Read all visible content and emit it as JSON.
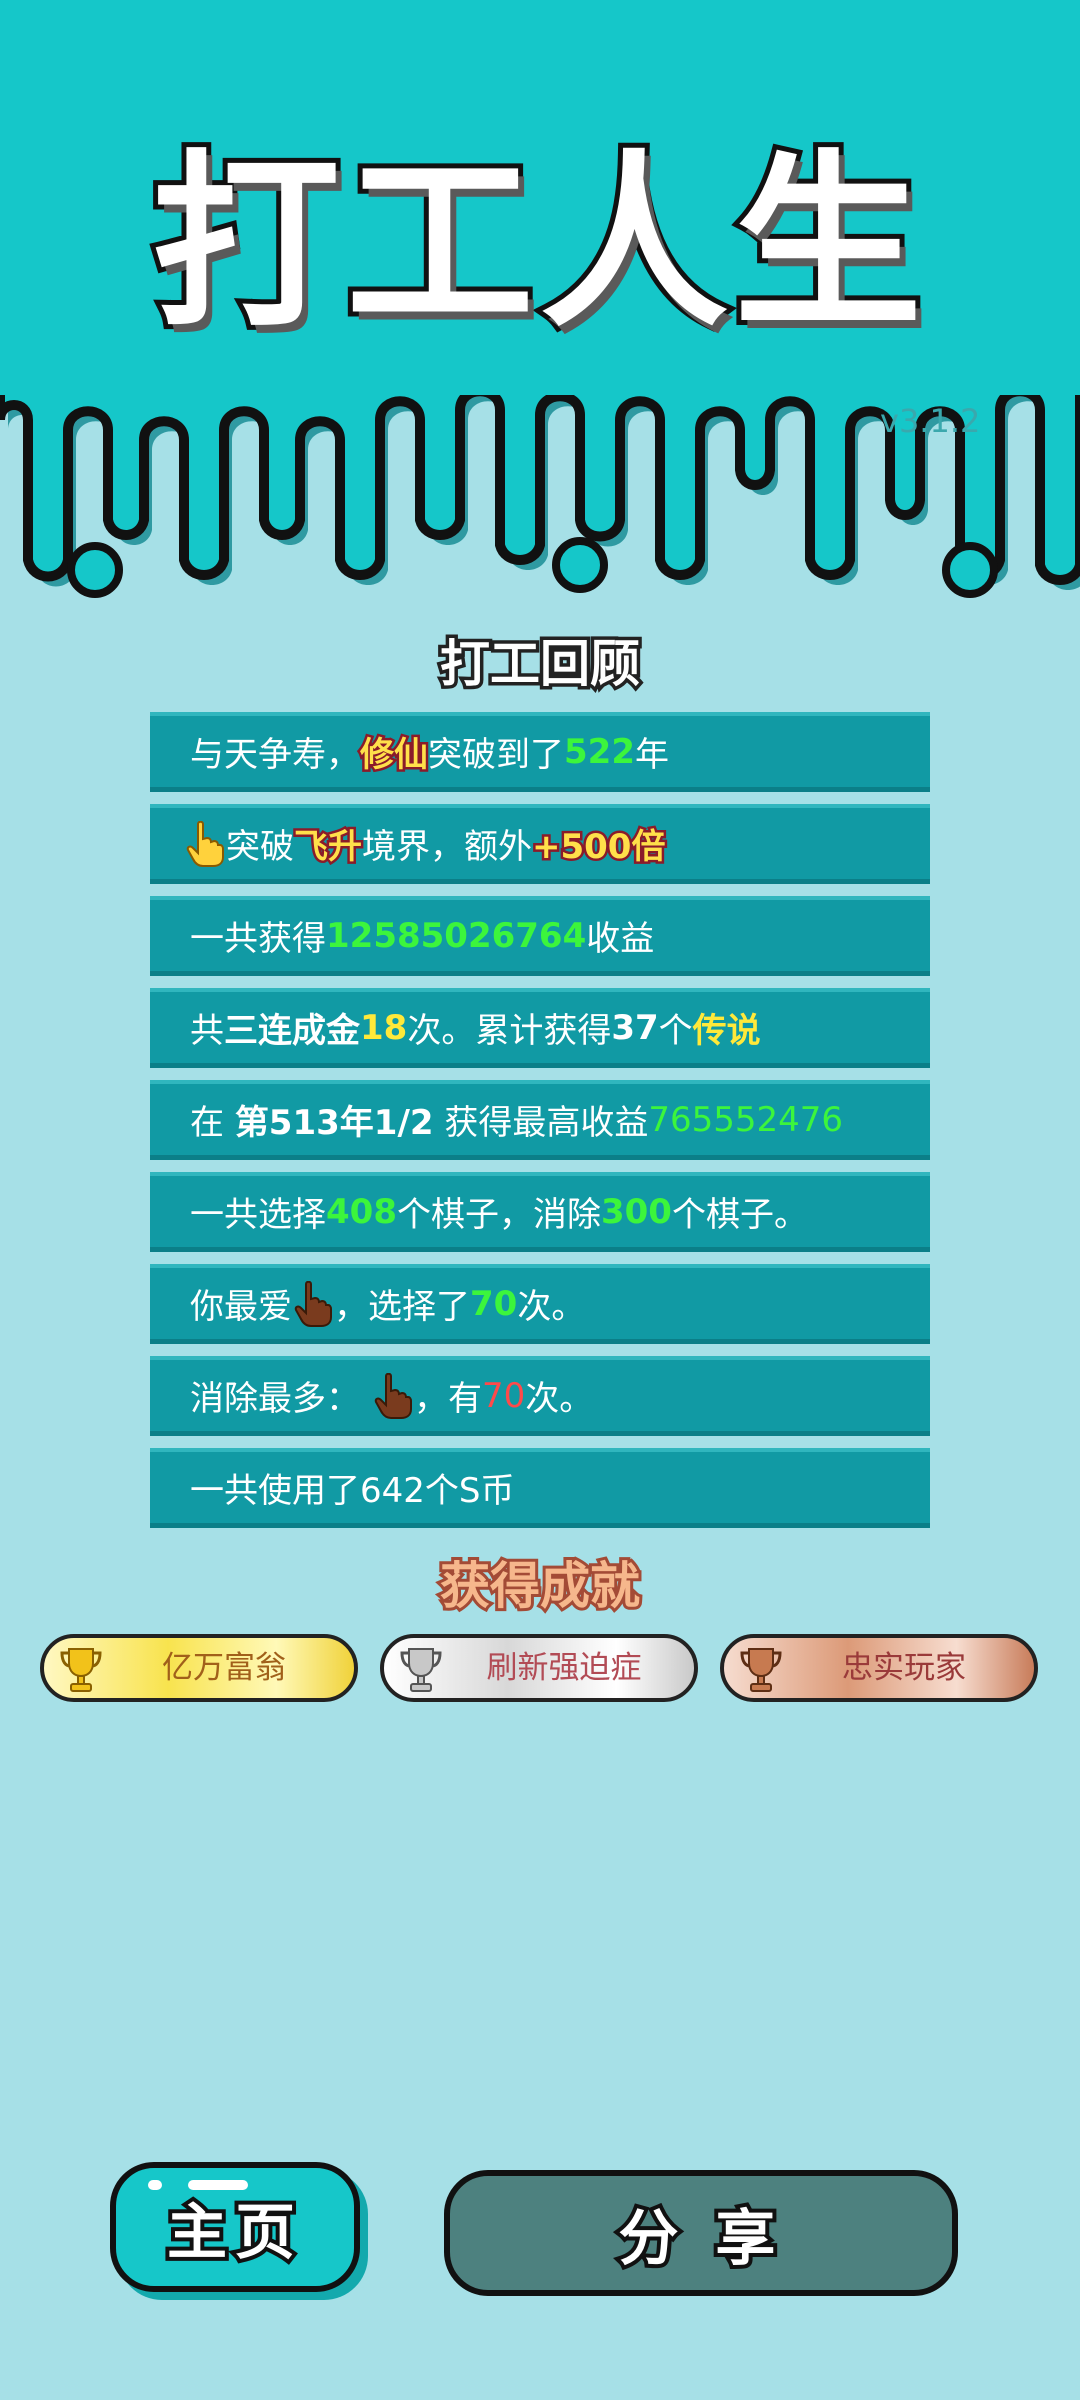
{
  "app": {
    "title": "打工人生",
    "version": "v3.1.2"
  },
  "review": {
    "title": "打工回顾",
    "rows": [
      {
        "a": "与天争寿，",
        "b": "修仙",
        "c": "突破到了",
        "d": "522",
        "e": "年"
      },
      {
        "a": "突破",
        "b": "飞升",
        "c": "境界，额外",
        "d": "+500倍"
      },
      {
        "a": "一共获得",
        "b": "12585026764",
        "c": "收益"
      },
      {
        "a": "共",
        "b": "三连成金",
        "c": "18",
        "d": "次。累计获得",
        "e": "37",
        "f": "个",
        "g": "传说"
      },
      {
        "a": "在 ",
        "b": "第513年1/2",
        "c": " 获得最高收益",
        "d": "765552476"
      },
      {
        "a": "一共选择",
        "b": "408",
        "c": "个棋子，消除",
        "d": "300",
        "e": "个棋子。"
      },
      {
        "a": "你最爱",
        "b": "，选择了",
        "c": "70",
        "d": "次。"
      },
      {
        "a": "消除最多：",
        "b": "，有",
        "c": "70",
        "d": "次。"
      },
      {
        "a": "一共使用了642个S币"
      }
    ]
  },
  "achievements": {
    "title": "获得成就",
    "items": [
      {
        "label": "亿万富翁",
        "color": "#f7e24a"
      },
      {
        "label": "刷新强迫症",
        "color": "#d6d6d6"
      },
      {
        "label": "忠实玩家",
        "color": "#d99575"
      }
    ]
  },
  "buttons": {
    "home": "主页",
    "share": "分 享"
  },
  "icons": {
    "pointer_hand": "pointing-hand-icon",
    "trophy": "trophy-icon"
  }
}
